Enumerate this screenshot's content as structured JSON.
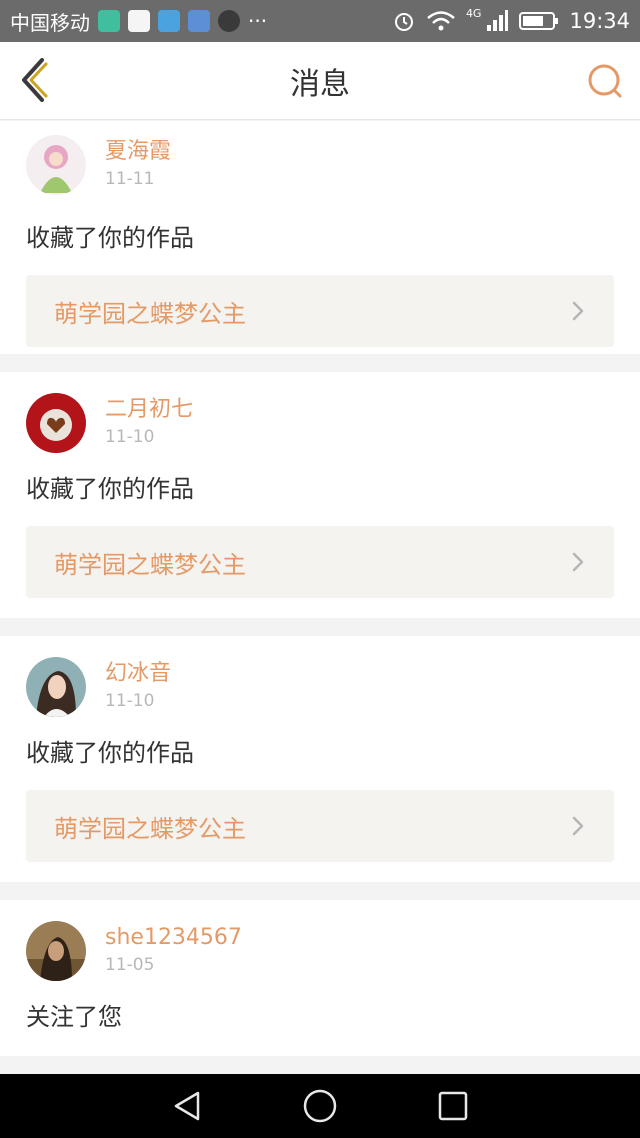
{
  "status_bar": {
    "carrier": "中国移动",
    "time": "19:34",
    "network": "4G",
    "more": "···"
  },
  "header": {
    "title": "消息",
    "back_icon": "chevron-left-icon",
    "search_icon": "search-icon"
  },
  "colors": {
    "accent": "#e49a67",
    "back_arrow": "#c9a521",
    "header_bg": "#ffffff",
    "page_bg": "#f3f3f3",
    "card_link_bg": "#f4f3ef"
  },
  "notifications": [
    {
      "name": "夏海霞",
      "date": "11-11",
      "action": "收藏了你的作品",
      "work": "萌学园之蝶梦公主"
    },
    {
      "name": "二月初七",
      "date": "11-10",
      "action": "收藏了你的作品",
      "work": "萌学园之蝶梦公主"
    },
    {
      "name": "幻冰音",
      "date": "11-10",
      "action": "收藏了你的作品",
      "work": "萌学园之蝶梦公主"
    },
    {
      "name": "she1234567",
      "date": "11-05",
      "action": "关注了您"
    }
  ]
}
